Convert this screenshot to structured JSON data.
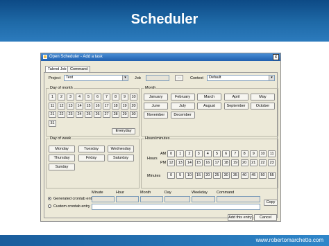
{
  "slide": {
    "title": "Scheduler",
    "url": "www.robertomarchetto.com"
  },
  "window": {
    "title": "Open Scheduler - Add a task",
    "close_label": "x"
  },
  "tabs": [
    "Talend Job",
    "Command"
  ],
  "form": {
    "project_label": "Project",
    "project_value": "Test",
    "job_label": "Job",
    "job_value": "",
    "browse_label": "...",
    "context_label": "Context",
    "context_value": "Default"
  },
  "day_of_month": {
    "title": "Day of month",
    "days": [
      "1",
      "2",
      "3",
      "4",
      "5",
      "6",
      "7",
      "8",
      "9",
      "10",
      "11",
      "12",
      "13",
      "14",
      "15",
      "16",
      "17",
      "18",
      "19",
      "20",
      "21",
      "22",
      "23",
      "24",
      "25",
      "26",
      "27",
      "28",
      "29",
      "30",
      "31"
    ],
    "everyday_label": "Everyday"
  },
  "month": {
    "title": "Month",
    "months": [
      "January",
      "February",
      "March",
      "April",
      "May",
      "June",
      "July",
      "August",
      "September",
      "October",
      "November",
      "December"
    ]
  },
  "day_of_week": {
    "title": "Day of week",
    "days": [
      "Monday",
      "Tuesday",
      "Wednesday",
      "Thursday",
      "Friday",
      "Saturday",
      "Sunday"
    ]
  },
  "hours_minutes": {
    "title": "Hours/minutes",
    "hours_label": "Hours",
    "am_label": "AM",
    "pm_label": "PM",
    "minutes_label": "Minutes",
    "am_hours": [
      "0",
      "1",
      "2",
      "3",
      "4",
      "5",
      "6",
      "7",
      "8",
      "9",
      "10",
      "11"
    ],
    "pm_hours": [
      "12",
      "13",
      "14",
      "15",
      "16",
      "17",
      "18",
      "19",
      "20",
      "21",
      "22",
      "23"
    ],
    "minutes": [
      "0",
      "5",
      "10",
      "15",
      "20",
      "25",
      "30",
      "35",
      "40",
      "45",
      "50",
      "55"
    ]
  },
  "crontab": {
    "columns": [
      "Minute",
      "Hour",
      "Month",
      "Day",
      "Weekday",
      "Command"
    ],
    "generated_label": "Generated crontab entry",
    "custom_label": "Custom crontab entry",
    "copy_label": "Copy",
    "generated_selected": true
  },
  "footer": {
    "add_label": "Add this entry",
    "cancel_label": "Cancel"
  }
}
